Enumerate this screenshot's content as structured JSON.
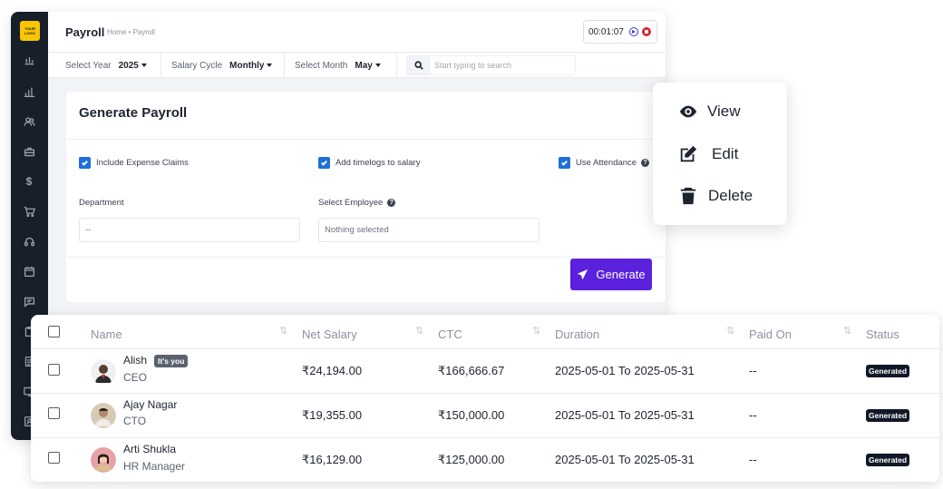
{
  "app": {
    "logo_text": "YOUR LOGO",
    "title": "Payroll",
    "breadcrumb": "Home • Payroll",
    "timer": "00:01:07"
  },
  "filters": {
    "year_label": "Select Year",
    "year_value": "2025",
    "cycle_label": "Salary Cycle",
    "cycle_value": "Monthly",
    "month_label": "Select Month",
    "month_value": "May",
    "search_placeholder": "Start typing to search"
  },
  "generate": {
    "title": "Generate Payroll",
    "include_expense": "Include Expense Claims",
    "add_timelogs": "Add timelogs to salary",
    "use_attendance": "Use Attendance",
    "department_label": "Department",
    "department_value": "--",
    "employee_label": "Select Employee",
    "employee_value": "Nothing selected",
    "button": "Generate"
  },
  "context_menu": {
    "view": "View",
    "edit": "Edit",
    "delete": "Delete"
  },
  "table": {
    "headers": {
      "name": "Name",
      "net_salary": "Net Salary",
      "ctc": "CTC",
      "duration": "Duration",
      "paid_on": "Paid On",
      "status": "Status"
    },
    "you_badge": "It's you",
    "rows": [
      {
        "name": "Alish",
        "role": "CEO",
        "net_salary": "₹24,194.00",
        "ctc": "₹166,666.67",
        "duration": "2025-05-01 To 2025-05-31",
        "paid_on": "--",
        "status": "Generated"
      },
      {
        "name": "Ajay Nagar",
        "role": "CTO",
        "net_salary": "₹19,355.00",
        "ctc": "₹150,000.00",
        "duration": "2025-05-01 To 2025-05-31",
        "paid_on": "--",
        "status": "Generated"
      },
      {
        "name": "Arti Shukla",
        "role": "HR Manager",
        "net_salary": "₹16,129.00",
        "ctc": "₹125,000.00",
        "duration": "2025-05-01 To 2025-05-31",
        "paid_on": "--",
        "status": "Generated"
      }
    ]
  },
  "colors": {
    "primary_button": "#5b21dc",
    "sidebar": "#171f29",
    "checkbox": "#1d6fdc",
    "logo": "#f7c600"
  }
}
